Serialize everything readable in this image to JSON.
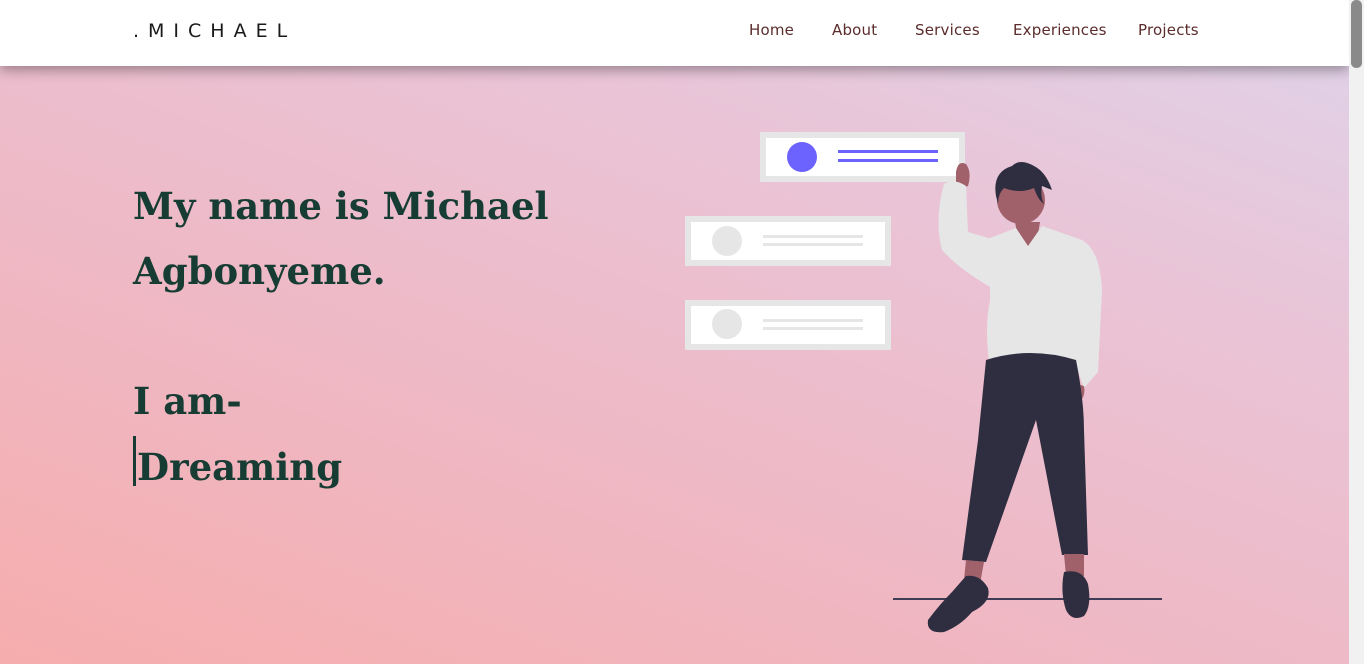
{
  "navbar": {
    "logo": ".MICHAEL",
    "links": [
      "Home",
      "About",
      "Services",
      "Experiences",
      "Projects"
    ]
  },
  "hero": {
    "headline": "My name is Michael Agbonyeme.",
    "iam": "I am-",
    "typed_word": "Dreaming"
  },
  "colors": {
    "heading": "#173c33",
    "nav_text": "#5b2c2c",
    "accent": "#6c63ff",
    "figure_dark": "#2f2e41"
  },
  "illustration": {
    "name": "person-with-floating-cards-illustration"
  }
}
